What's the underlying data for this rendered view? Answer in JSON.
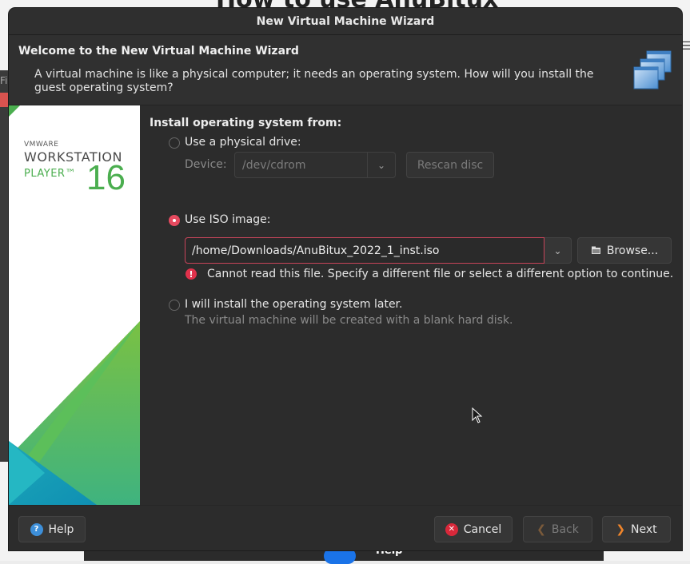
{
  "background": {
    "title_partial": "How to use AnuBitux",
    "left_strip_text": "Fil",
    "bottom_help_label": "Help"
  },
  "window": {
    "title": "New Virtual Machine Wizard"
  },
  "header": {
    "title": "Welcome to the New Virtual Machine Wizard",
    "description": "A virtual machine is like a physical computer; it needs an operating system. How will you install the guest operating system?",
    "icon": "stacked-windows-icon"
  },
  "brand": {
    "vendor": "VMWARE",
    "product": "WORKSTATION",
    "edition": "PLAYER™",
    "version": "16"
  },
  "install": {
    "section_title": "Install operating system from:",
    "selected": "iso",
    "physical": {
      "label": "Use a physical drive:",
      "device_label": "Device:",
      "device_value": "/dev/cdrom",
      "rescan_label": "Rescan disc"
    },
    "iso": {
      "label": "Use ISO image:",
      "path": "/home/Downloads/AnuBitux_2022_1_inst.iso",
      "browse_label": "Browse...",
      "error": "Cannot read this file. Specify a different file or select a different option to continue."
    },
    "later": {
      "label": "I will install the operating system later.",
      "description": "The virtual machine will be created with a blank hard disk."
    }
  },
  "footer": {
    "help_label": "Help",
    "cancel_label": "Cancel",
    "back_label": "Back",
    "next_label": "Next"
  },
  "colors": {
    "accent": "#e64a5f",
    "error": "#e0314b",
    "brand_green": "#4bae4f",
    "next_arrow": "#f0852b",
    "help_blue": "#3d8fd9"
  }
}
